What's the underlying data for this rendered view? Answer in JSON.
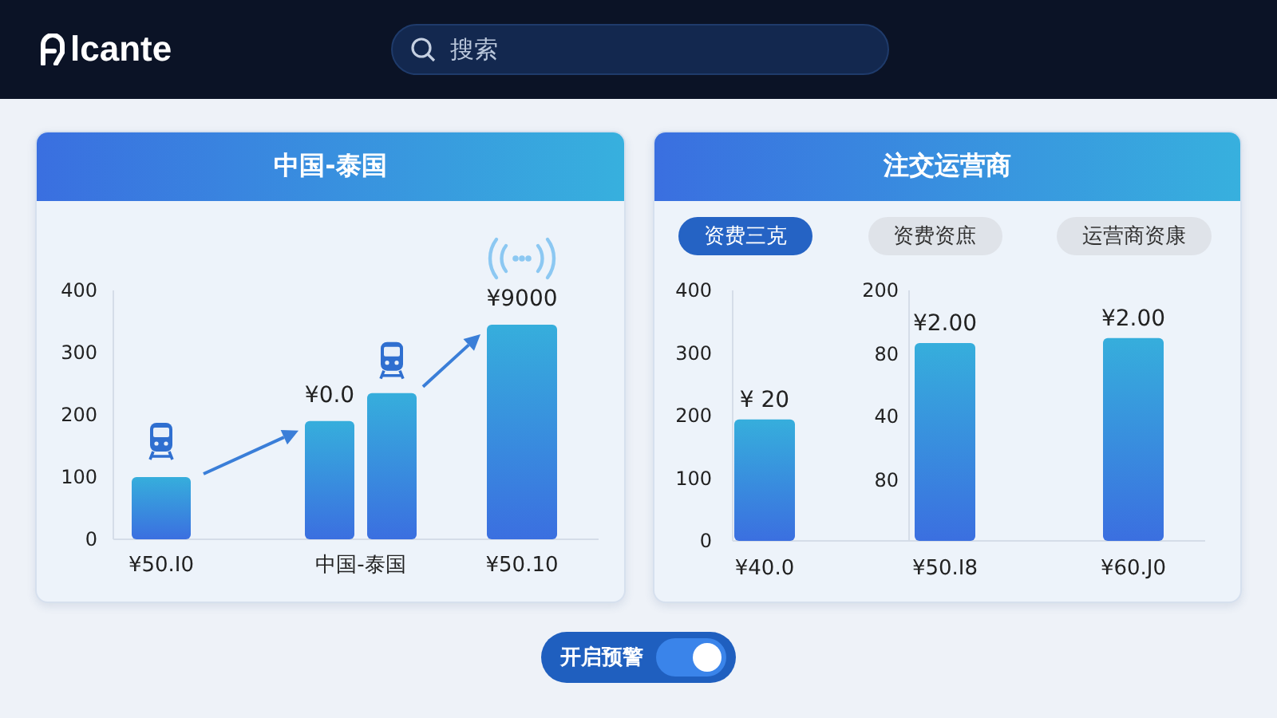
{
  "header": {
    "logo": "lcante",
    "search": {
      "placeholder": "搜索"
    }
  },
  "cards": [
    {
      "title": "中国-泰国",
      "chart_data": {
        "type": "bar",
        "categories": [
          "¥50.I0",
          "中国-泰国",
          "¥50.10"
        ],
        "series": [
          {
            "values": [
              100,
              190,
              345
            ]
          },
          {
            "values": [
              null,
              235,
              null
            ]
          }
        ],
        "yticks": [
          0,
          100,
          200,
          300,
          400
        ],
        "ylim": [
          0,
          400
        ],
        "annotations": [
          "¥0.0",
          "¥9000"
        ]
      }
    },
    {
      "title": "注交运营商",
      "tabs": [
        {
          "label": "资费三克",
          "selected": true
        },
        {
          "label": "资费资庶",
          "selected": false
        },
        {
          "label": "运营商资康",
          "selected": false
        }
      ],
      "axis_labels": [
        "200",
        "80",
        "40",
        "80"
      ],
      "bar_labels": [
        "¥ 20",
        "¥2.00",
        "¥2.00"
      ],
      "chart_data": {
        "type": "bar",
        "categories": [
          "¥40.0",
          "¥50.I8",
          "¥60.J0"
        ],
        "values": [
          194,
          316,
          324
        ],
        "yticks": [
          0,
          100,
          200,
          300,
          400
        ],
        "ylim": [
          0,
          400
        ]
      }
    }
  ],
  "toggle": {
    "label": "开启预警",
    "on": true
  }
}
